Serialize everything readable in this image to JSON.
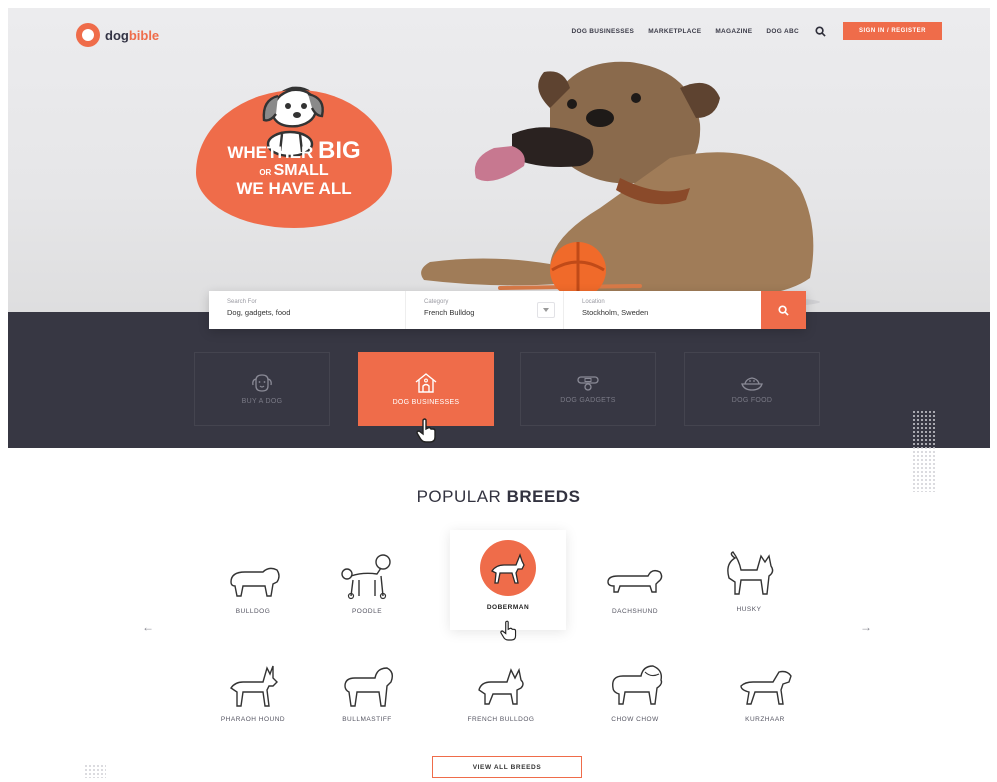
{
  "header": {
    "logo_left": "dog",
    "logo_right": "bible",
    "nav": [
      "DOG BUSINESSES",
      "MARKETPLACE",
      "MAGAZINE",
      "DOG ABC"
    ],
    "signin_label": "SIGN IN / REGISTER"
  },
  "hero": {
    "line1_pre": "WHETHER ",
    "line1_big": "BIG",
    "line2_or": "OR ",
    "line2_word": "SMALL",
    "line3": "WE HAVE ALL"
  },
  "search": {
    "what_label": "Search For",
    "what_value": "Dog, gadgets, food",
    "category_label": "Category",
    "category_value": "French Bulldog",
    "location_label": "Location",
    "location_value": "Stockholm, Sweden"
  },
  "categories": [
    {
      "label": "BUY A DOG",
      "icon": "dog-face-icon",
      "active": false
    },
    {
      "label": "DOG BUSINESSES",
      "icon": "dog-house-icon",
      "active": true
    },
    {
      "label": "DOG GADGETS",
      "icon": "collar-icon",
      "active": false
    },
    {
      "label": "DOG FOOD",
      "icon": "food-bowl-icon",
      "active": false
    }
  ],
  "popular": {
    "title_light": "POPULAR ",
    "title_bold": "BREEDS",
    "prev_arrow": "←",
    "next_arrow": "→",
    "breeds": [
      "BULLDOG",
      "POODLE",
      "DOBERMAN",
      "DACHSHUND",
      "HUSKY",
      "PHARAOH HOUND",
      "BULLMASTIFF",
      "FRENCH BULLDOG",
      "CHOW CHOW",
      "KURZHAAR"
    ],
    "featured": "DOBERMAN",
    "view_all_label": "VIEW ALL BREEDS"
  },
  "colors": {
    "accent": "#ef6c4a",
    "dark_band": "#373743"
  }
}
